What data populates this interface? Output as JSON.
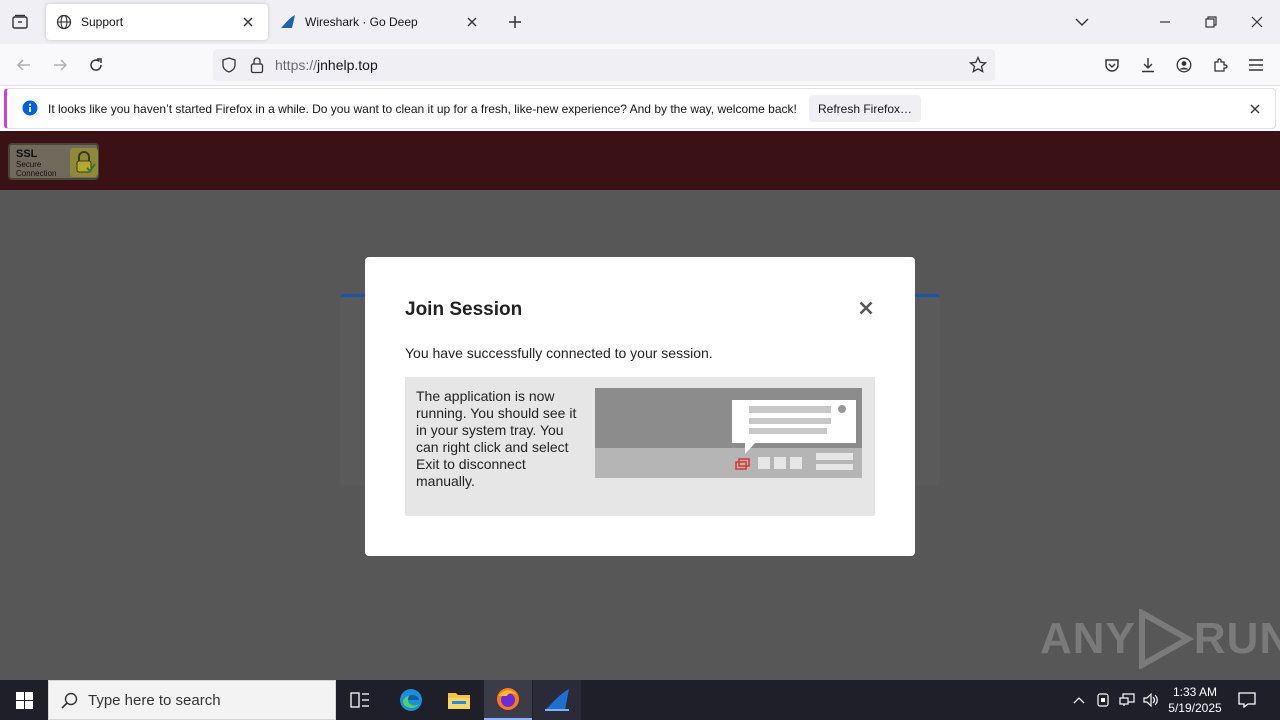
{
  "browser": {
    "tabs": [
      {
        "title": "Support",
        "icon": "globe-icon",
        "active": true
      },
      {
        "title": "Wireshark · Go Deep",
        "icon": "wireshark-fin-icon",
        "active": false
      }
    ],
    "url": {
      "protocol": "https://",
      "host": "jnhelp.top"
    },
    "notification": {
      "message": "It looks like you haven’t started Firefox in a while. Do you want to clean it up for a fresh, like-new experience? And by the way, welcome back!",
      "button_label": "Refresh Firefox…"
    }
  },
  "page": {
    "ssl_badge": {
      "line1": "SSL",
      "line2": "Secure",
      "line3": "Connection"
    },
    "modal": {
      "title": "Join Session",
      "message": "You have successfully connected to your session.",
      "info_text": "The application is now running. You should see it in your system tray. You can right click and select Exit to disconnect manually."
    }
  },
  "watermark": {
    "left": "ANY",
    "right": "RUN"
  },
  "taskbar": {
    "search_placeholder": "Type here to search",
    "pinned": [
      "task-view-icon",
      "edge-icon",
      "file-explorer-icon",
      "firefox-icon",
      "wireshark-icon"
    ],
    "clock": {
      "time": "1:33 AM",
      "date": "5/19/2025"
    }
  },
  "colors": {
    "header_bg": "#3a1115",
    "page_overlay": "#575757",
    "notif_accent": "#d13edb",
    "card_accent": "#1f55a8"
  }
}
